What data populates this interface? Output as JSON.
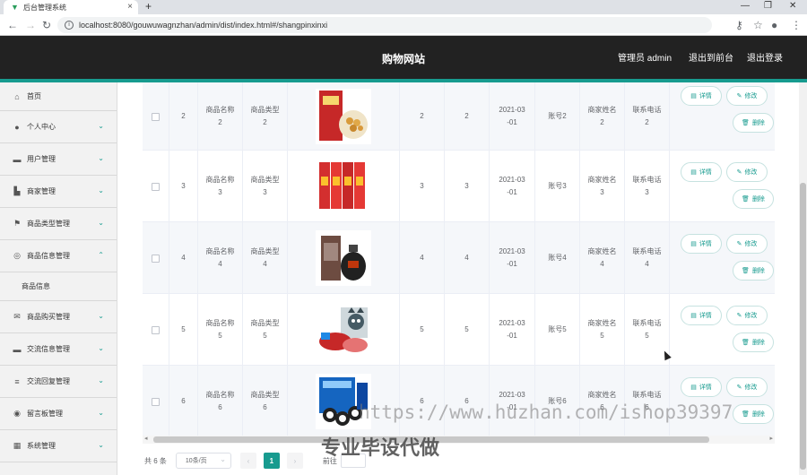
{
  "browser": {
    "tab_title": "后台管理系统",
    "url": "localhost:8080/gouwuwagnzhan/admin/dist/index.html#/shangpinxinxi"
  },
  "header": {
    "title": "购物网站",
    "user": "管理员 admin",
    "front_link": "退出到前台",
    "logout": "退出登录"
  },
  "sidebar": {
    "items": [
      {
        "label": "首页",
        "icon": "home-icon"
      },
      {
        "label": "个人中心",
        "icon": "user-icon"
      },
      {
        "label": "用户管理",
        "icon": "users-icon"
      },
      {
        "label": "商家管理",
        "icon": "store-icon"
      },
      {
        "label": "商品类型管理",
        "icon": "flag-icon"
      },
      {
        "label": "商品信息管理",
        "icon": "info-icon"
      },
      {
        "label": "商品购买管理",
        "icon": "mail-icon"
      },
      {
        "label": "交流信息管理",
        "icon": "chat-icon"
      },
      {
        "label": "交流回复管理",
        "icon": "reply-icon"
      },
      {
        "label": "留言板管理",
        "icon": "board-icon"
      },
      {
        "label": "系统管理",
        "icon": "grid-icon"
      }
    ],
    "sub_item": "商品信息"
  },
  "table": {
    "rows": [
      {
        "no": "2",
        "name": "商品名称\n2",
        "type": "商品类型\n2",
        "price": "2",
        "stock": "2",
        "date": "2021-03\n-01",
        "account": "账号2",
        "merchant": "商家姓名\n2",
        "phone": "联系电话\n2",
        "img": "snack-food"
      },
      {
        "no": "3",
        "name": "商品名称\n3",
        "type": "商品类型\n3",
        "price": "3",
        "stock": "3",
        "date": "2021-03\n-01",
        "account": "账号3",
        "merchant": "商家姓名\n3",
        "phone": "联系电话\n3",
        "img": "red-boxes"
      },
      {
        "no": "4",
        "name": "商品名称\n4",
        "type": "商品类型\n4",
        "price": "4",
        "stock": "4",
        "date": "2021-03\n-01",
        "account": "账号4",
        "merchant": "商家姓名\n4",
        "phone": "联系电话\n4",
        "img": "liquor-jar"
      },
      {
        "no": "5",
        "name": "商品名称\n5",
        "type": "商品类型\n5",
        "price": "5",
        "stock": "5",
        "date": "2021-03\n-01",
        "account": "账号5",
        "merchant": "商家姓名\n5",
        "phone": "联系电话\n5",
        "img": "pet-snacks"
      },
      {
        "no": "6",
        "name": "商品名称\n6",
        "type": "商品类型\n6",
        "price": "6",
        "stock": "6",
        "date": "2021-03\n-01",
        "account": "账号6",
        "merchant": "商家姓名\n6",
        "phone": "联系电话\n6",
        "img": "cookies-box"
      }
    ],
    "btn_detail": "详情",
    "btn_edit": "修改",
    "btn_delete": "删除"
  },
  "pager": {
    "total": "共 6 条",
    "page_size": "10条/页",
    "current": "1",
    "goto": "前往"
  },
  "watermark": {
    "url": "https://www.huzhan.com/ishop39397",
    "slogan": "专业毕设代做"
  },
  "colors": {
    "accent": "#179b8f",
    "header_bg": "#222222"
  }
}
